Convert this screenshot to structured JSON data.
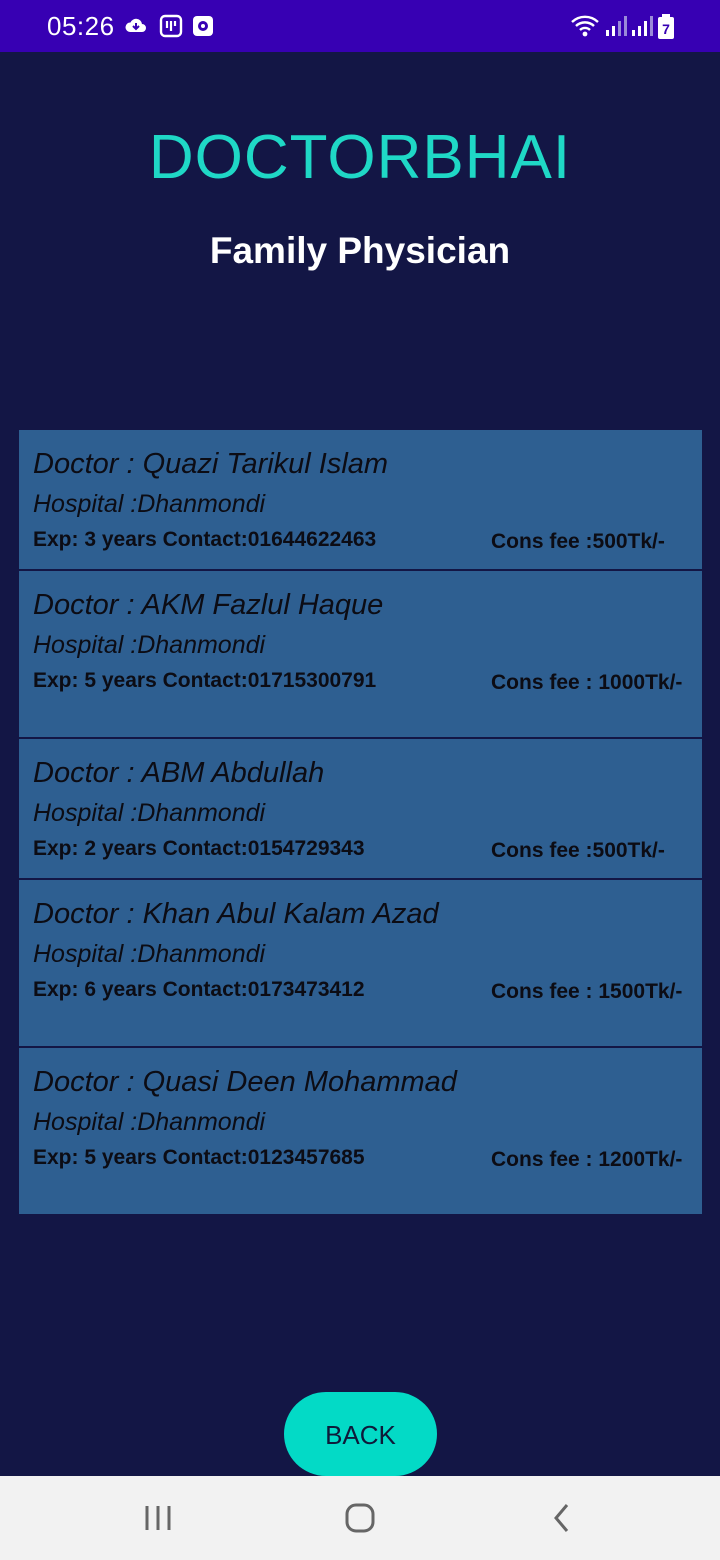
{
  "status_bar": {
    "time": "05:26",
    "icons": [
      "cloud-icon",
      "app-badge-icon",
      "screen-record-icon",
      "wifi-icon",
      "signal-icon",
      "signal-icon-2",
      "battery-icon"
    ],
    "battery_level": "7"
  },
  "header": {
    "app_title": "DOCTORBHAI",
    "page_title": "Family Physician"
  },
  "doctors": [
    {
      "name": "Doctor : Quazi Tarikul Islam",
      "hospital": "Hospital :Dhanmondi",
      "exp": "Exp: 3 years Contact:01644622463",
      "fee": "Cons fee :500Tk/-"
    },
    {
      "name": "Doctor : AKM Fazlul Haque",
      "hospital": "Hospital :Dhanmondi",
      "exp": "Exp: 5 years Contact:01715300791",
      "fee": "Cons fee : 1000Tk/-"
    },
    {
      "name": "Doctor : ABM Abdullah",
      "hospital": "Hospital :Dhanmondi",
      "exp": "Exp: 2 years Contact:0154729343",
      "fee": "Cons fee :500Tk/-"
    },
    {
      "name": "Doctor : Khan Abul Kalam Azad",
      "hospital": "Hospital :Dhanmondi",
      "exp": "Exp: 6 years Contact:0173473412",
      "fee": "Cons fee : 1500Tk/-"
    },
    {
      "name": "Doctor : Quasi Deen Mohammad",
      "hospital": "Hospital :Dhanmondi",
      "exp": "Exp: 5 years Contact:0123457685",
      "fee": "Cons fee : 1200Tk/-"
    }
  ],
  "back_button": {
    "label": "BACK"
  },
  "nav_bar": {
    "icons": [
      "recent-apps-icon",
      "home-icon",
      "back-arrow-icon"
    ]
  },
  "colors": {
    "background": "#131645",
    "status_bar": "#3700b3",
    "accent": "#03dac6",
    "card": "#2e5f91",
    "title": "#1fd8c6"
  }
}
